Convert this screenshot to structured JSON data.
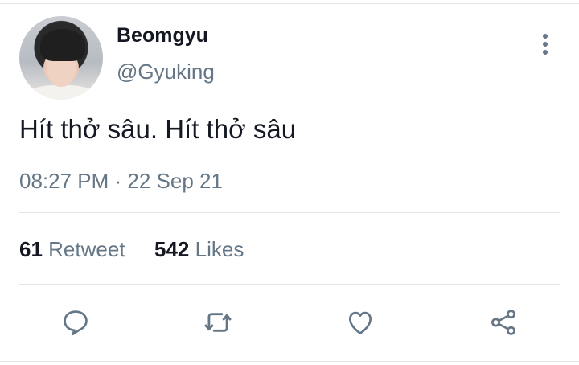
{
  "tweet": {
    "display_name": "Beomgyu",
    "handle": "@Gyuking",
    "text": "Hít thở sâu. Hít thở sâu",
    "timestamp": "08:27 PM · 22 Sep 21"
  },
  "stats": {
    "retweets_count": "61",
    "retweets_label": "Retweet",
    "likes_count": "542",
    "likes_label": "Likes"
  },
  "actions": [
    "reply-icon",
    "retweet-icon",
    "like-icon",
    "share-icon"
  ],
  "colors": {
    "primary_text": "#141823",
    "secondary_text": "#657786",
    "divider": "#e1e8ed"
  }
}
